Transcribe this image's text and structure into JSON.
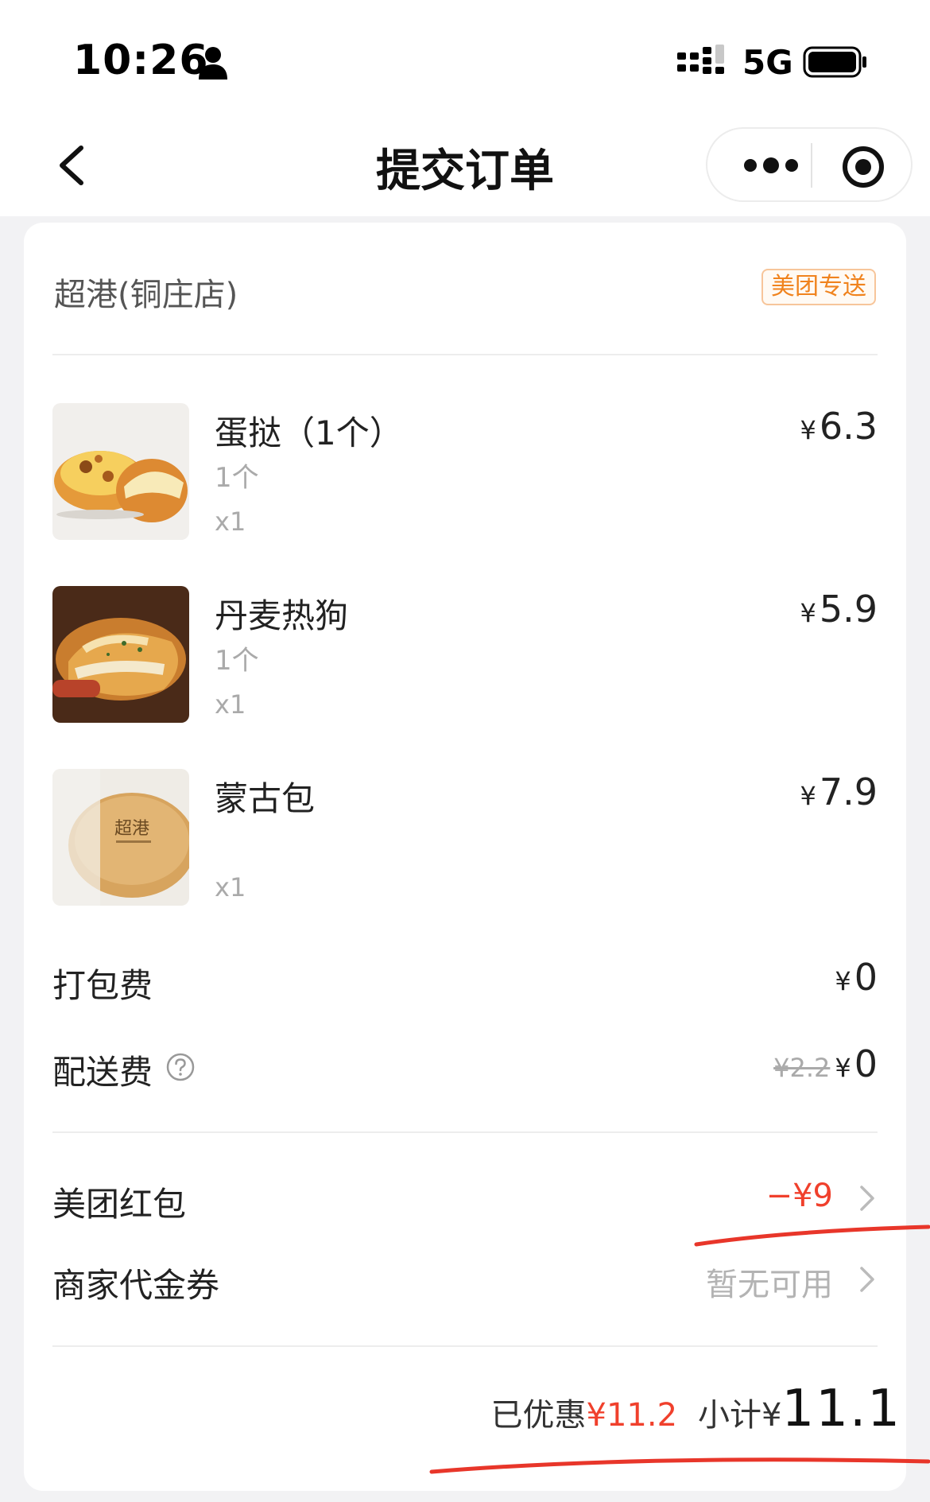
{
  "status_bar": {
    "time": "10:26",
    "network": "5G"
  },
  "nav": {
    "title": "提交订单"
  },
  "store": {
    "name": "超港(铜庄店)",
    "delivery_badge": "美团专送"
  },
  "items": [
    {
      "name": "蛋挞（1个）",
      "spec": "1个",
      "qty": "x1",
      "price": "6.3",
      "currency": "¥"
    },
    {
      "name": "丹麦热狗",
      "spec": "1个",
      "qty": "x1",
      "price": "5.9",
      "currency": "¥"
    },
    {
      "name": "蒙古包",
      "spec": "",
      "qty": "x1",
      "price": "7.9",
      "currency": "¥",
      "image_logo_text": "超港"
    }
  ],
  "fees": {
    "packing": {
      "label": "打包费",
      "currency": "¥",
      "value": "0"
    },
    "delivery": {
      "label": "配送费",
      "original": "¥2.2",
      "currency": "¥",
      "value": "0"
    }
  },
  "discounts": {
    "red_packet": {
      "label": "美团红包",
      "value": "−¥9"
    },
    "voucher": {
      "label": "商家代金券",
      "value": "暂无可用"
    }
  },
  "summary": {
    "saved_label": "已优惠",
    "saved_value": "¥11.2",
    "subtotal_label": "小计¥",
    "subtotal_value": "11.1"
  },
  "colors": {
    "accent_red": "#f0402c",
    "badge_orange": "#f0831e",
    "annotation_red": "#e8362a"
  }
}
